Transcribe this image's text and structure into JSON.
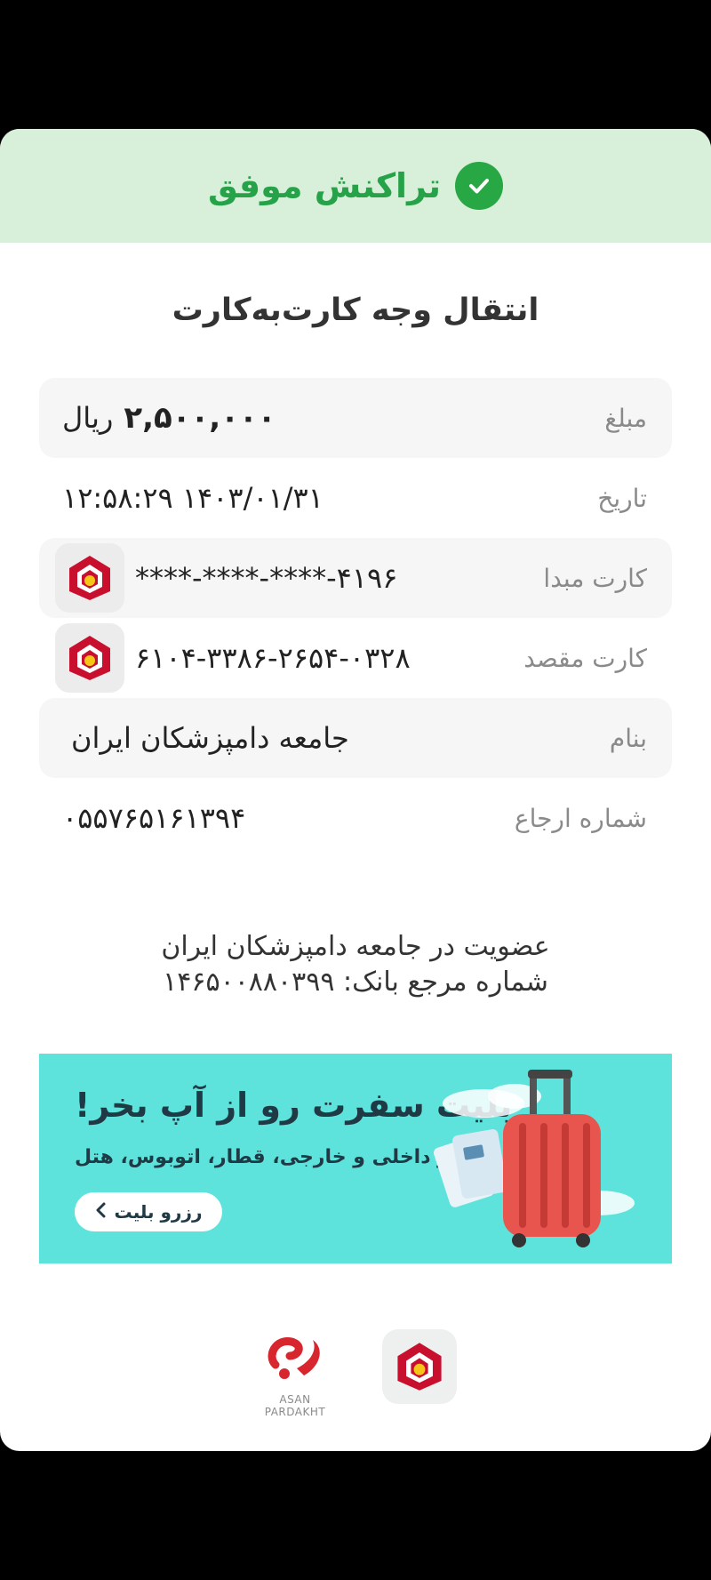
{
  "status": {
    "text": "تراکنش موفق",
    "icon": "check-icon",
    "color": "#26a248"
  },
  "title": "انتقال وجه کارت‌به‌کارت",
  "rows": {
    "amount": {
      "label": "مبلغ",
      "value": "۲,۵۰۰,۰۰۰",
      "currency": "ریال"
    },
    "date": {
      "label": "تاریخ",
      "value": "۱۲:۵۸:۲۹ ۱۴۰۳/۰۱/۳۱"
    },
    "source_card": {
      "label": "کارت مبدا",
      "value": "****-****-****-۴۱۹۶",
      "icon": "bank-mellat-logo"
    },
    "dest_card": {
      "label": "کارت مقصد",
      "value": "۶۱۰۴-۳۳۸۶-۲۶۵۴-۰۳۲۸",
      "icon": "bank-mellat-logo"
    },
    "name": {
      "label": "بنام",
      "value": "جامعه دامپزشکان ایران"
    },
    "ref": {
      "label": "شماره ارجاع",
      "value": "۰۵۵۷۶۵۱۶۱۳۹۴"
    }
  },
  "note": {
    "line1": "عضویت در جامعه دامپزشکان ایران",
    "line2": "شماره مرجع بانک: ۱۴۶۵۰۰۸۸۰۳۹۹"
  },
  "banner": {
    "title": "بلیت سفرت رو از آپ بخر!",
    "subtitle": "پرواز داخلی و خارجی، قطار، اتوبوس، هتل",
    "button": "رزرو بلیت"
  },
  "footer": {
    "asan_label": "ASAN PARDAKHT"
  }
}
